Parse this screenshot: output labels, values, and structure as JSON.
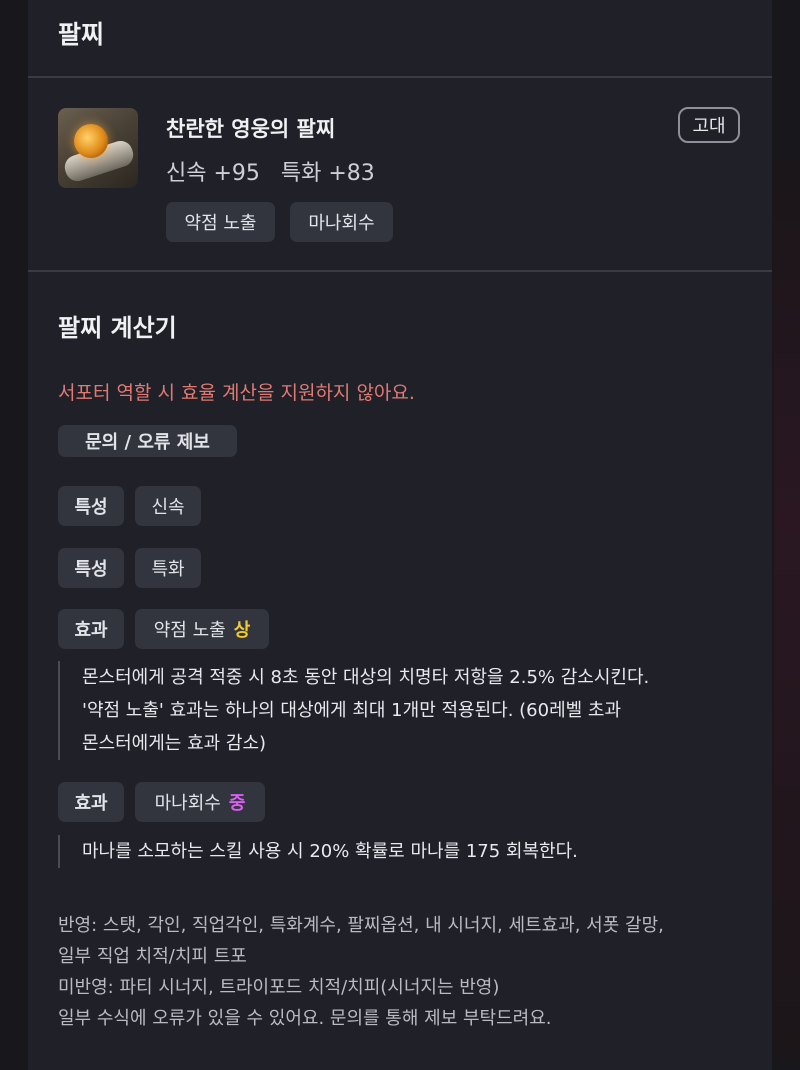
{
  "bracelet_section": {
    "title": "팔찌",
    "item": {
      "name": "찬란한 영웅의 팔찌",
      "stats": "신속 +95   특화 +83",
      "grade": "고대",
      "tags": [
        "약점 노출",
        "마나회수"
      ]
    }
  },
  "calculator": {
    "title": "팔찌 계산기",
    "warning": "서포터 역할 시 효율 계산을 지원하지 않아요.",
    "report_button": "문의 / 오류 제보",
    "rows": [
      {
        "label": "특성",
        "value": "신속"
      },
      {
        "label": "특성",
        "value": "특화"
      }
    ],
    "effects": [
      {
        "label": "효과",
        "name": "약점 노출",
        "grade": "상",
        "lines": [
          "몬스터에게 공격 적중 시 8초 동안 대상의 치명타 저항을 2.5% 감소시킨다.",
          "'약점 노출' 효과는 하나의 대상에게 최대 1개만 적용된다. (60레벨 초과",
          "몬스터에게는 효과 감소)"
        ]
      },
      {
        "label": "효과",
        "name": "마나회수",
        "grade": "중",
        "lines": [
          "마나를 소모하는 스킬 사용 시 20% 확률로 마나를 175 회복한다."
        ]
      }
    ],
    "footer": [
      "반영: 스탯, 각인, 직업각인, 특화계수, 팔찌옵션, 내 시너지, 세트효과, 서폿 갈망,",
      "일부 직업 치적/치피 트포",
      "미반영: 파티 시너지, 트라이포드 치적/치피(시너지는 반영)",
      "일부 수식에 오류가 있을 수 있어요. 문의를 통해 제보 부탁드려요."
    ]
  },
  "colors": {
    "grade_high": "#f1cc2c",
    "grade_mid": "#d85ff0",
    "warning": "#e07a72"
  }
}
